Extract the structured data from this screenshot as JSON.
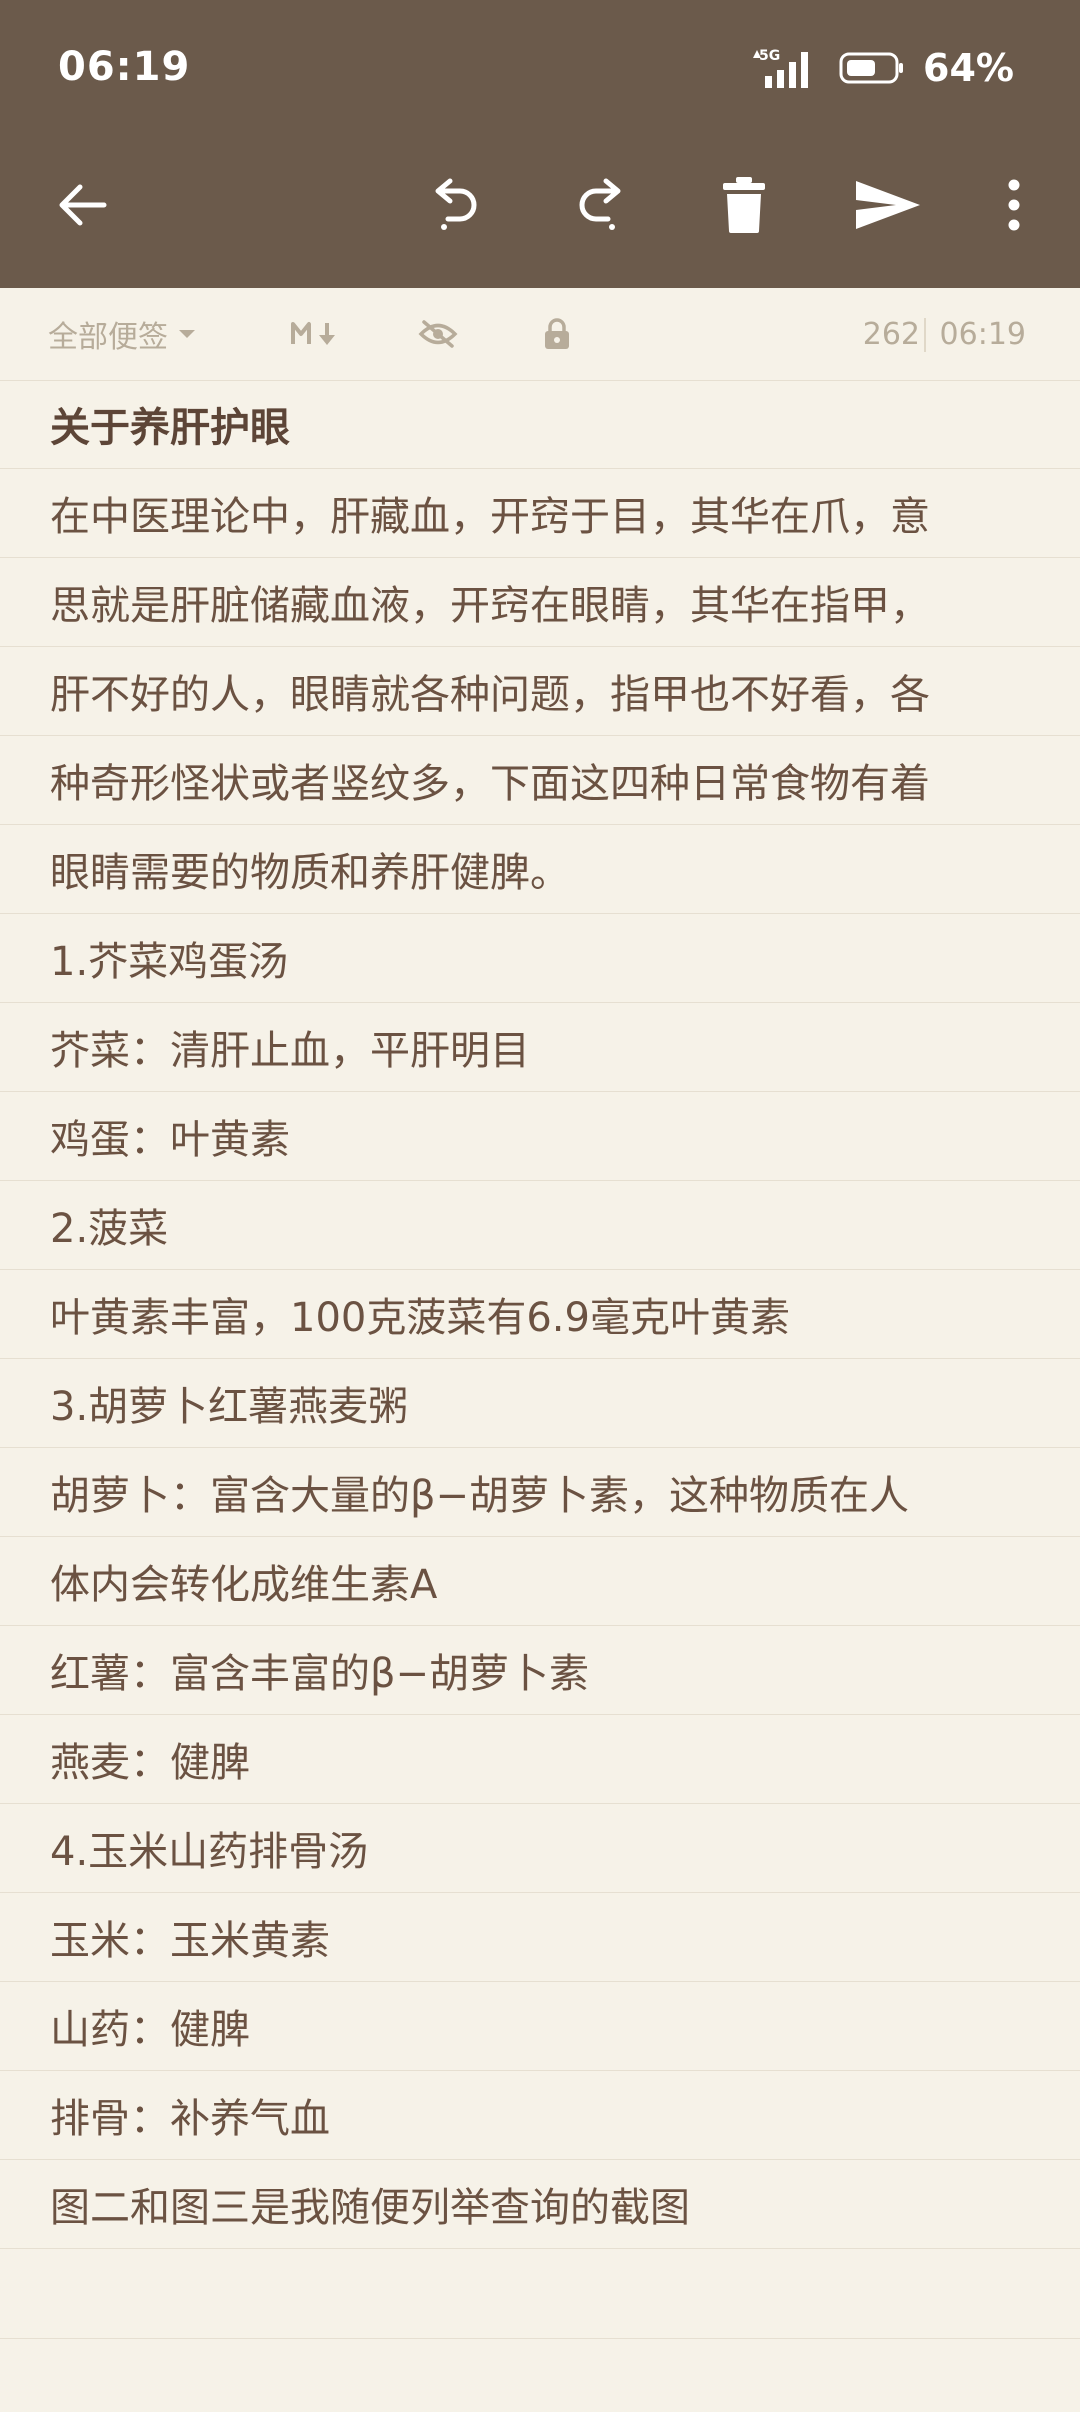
{
  "status_bar": {
    "time": "06:19",
    "network": "5G",
    "battery_pct": "64%",
    "battery_level": 0.64
  },
  "toolbar": {
    "icons": [
      "back-icon",
      "undo-icon",
      "redo-icon",
      "delete-icon",
      "send-icon",
      "more-icon"
    ]
  },
  "meta": {
    "folder": "全部便签",
    "char_count": "262",
    "time": "06:19",
    "icons": [
      "markdown-icon",
      "hide-icon",
      "lock-icon"
    ]
  },
  "note": {
    "title": "关于养肝护眼",
    "lines": [
      "在中医理论中，肝藏血，开窍于目，其华在爪，意",
      "思就是肝脏储藏血液，开窍在眼睛，其华在指甲，",
      "肝不好的人，眼睛就各种问题，指甲也不好看，各",
      "种奇形怪状或者竖纹多，下面这四种日常食物有着",
      "眼睛需要的物质和养肝健脾。",
      "1.芥菜鸡蛋汤",
      "芥菜：清肝止血，平肝明目",
      "鸡蛋：叶黄素",
      "2.菠菜",
      "叶黄素丰富，100克菠菜有6.9毫克叶黄素",
      "3.胡萝卜红薯燕麦粥",
      "胡萝卜：富含大量的β−胡萝卜素，这种物质在人",
      "体内会转化成维生素A",
      "红薯：富含丰富的β−胡萝卜素",
      "燕麦：健脾",
      "4.玉米山药排骨汤",
      "玉米：玉米黄素",
      "山药：健脾",
      "排骨：补养气血",
      "图二和图三是我随便列举查询的截图"
    ]
  },
  "colors": {
    "header_bg": "#6b5a4b",
    "page_bg": "#f6f2e8",
    "text": "#6b5242",
    "muted": "#b7ac9a",
    "rule": "#e6dfd1"
  }
}
